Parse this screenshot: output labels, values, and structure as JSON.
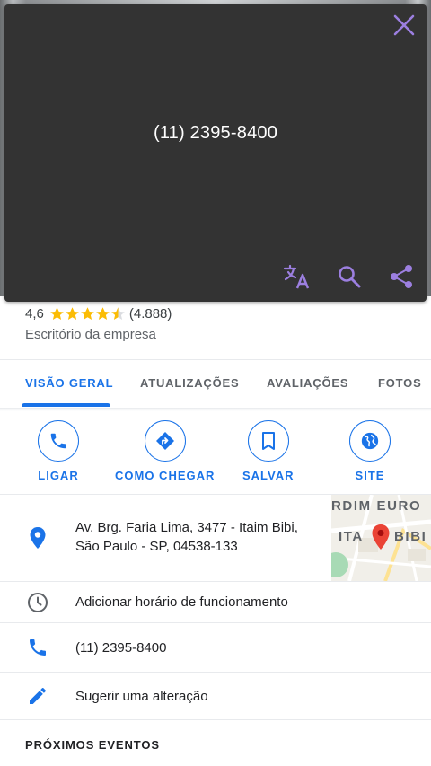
{
  "popup": {
    "phone_text": "(11) 2395-8400",
    "accent_color": "#9c7fe0",
    "icons": [
      "close-icon",
      "translate-icon",
      "search-icon",
      "share-icon"
    ]
  },
  "place": {
    "rating": "4,6",
    "stars": 4.5,
    "review_count": "(4.888)",
    "category": "Escritório da empresa"
  },
  "tabs": [
    {
      "label": "VISÃO GERAL",
      "active": true
    },
    {
      "label": "ATUALIZAÇÕES",
      "active": false
    },
    {
      "label": "AVALIAÇÕES",
      "active": false
    },
    {
      "label": "FOTOS",
      "active": false
    }
  ],
  "actions": [
    {
      "label": "LIGAR",
      "icon": "phone-icon"
    },
    {
      "label": "COMO CHEGAR",
      "icon": "directions-icon"
    },
    {
      "label": "SALVAR",
      "icon": "bookmark-icon"
    },
    {
      "label": "SITE",
      "icon": "globe-icon"
    }
  ],
  "details": {
    "address_line1": "Av. Brg. Faria Lima, 3477 - Itaim Bibi,",
    "address_line2": "São Paulo - SP, 04538-133",
    "hours": "Adicionar horário de funcionamento",
    "phone": "(11) 2395-8400",
    "suggest": "Sugerir uma alteração"
  },
  "map": {
    "label_top": "RDIM EURO",
    "label_mid_left": "ITA",
    "label_mid_right": "BIBI"
  },
  "sections": {
    "events_title": "PRÓXIMOS EVENTOS"
  },
  "colors": {
    "accent_blue": "#1a73e8",
    "star_yellow": "#fbbc04",
    "popup_bg": "#333333",
    "pin_red": "#ea4335"
  }
}
